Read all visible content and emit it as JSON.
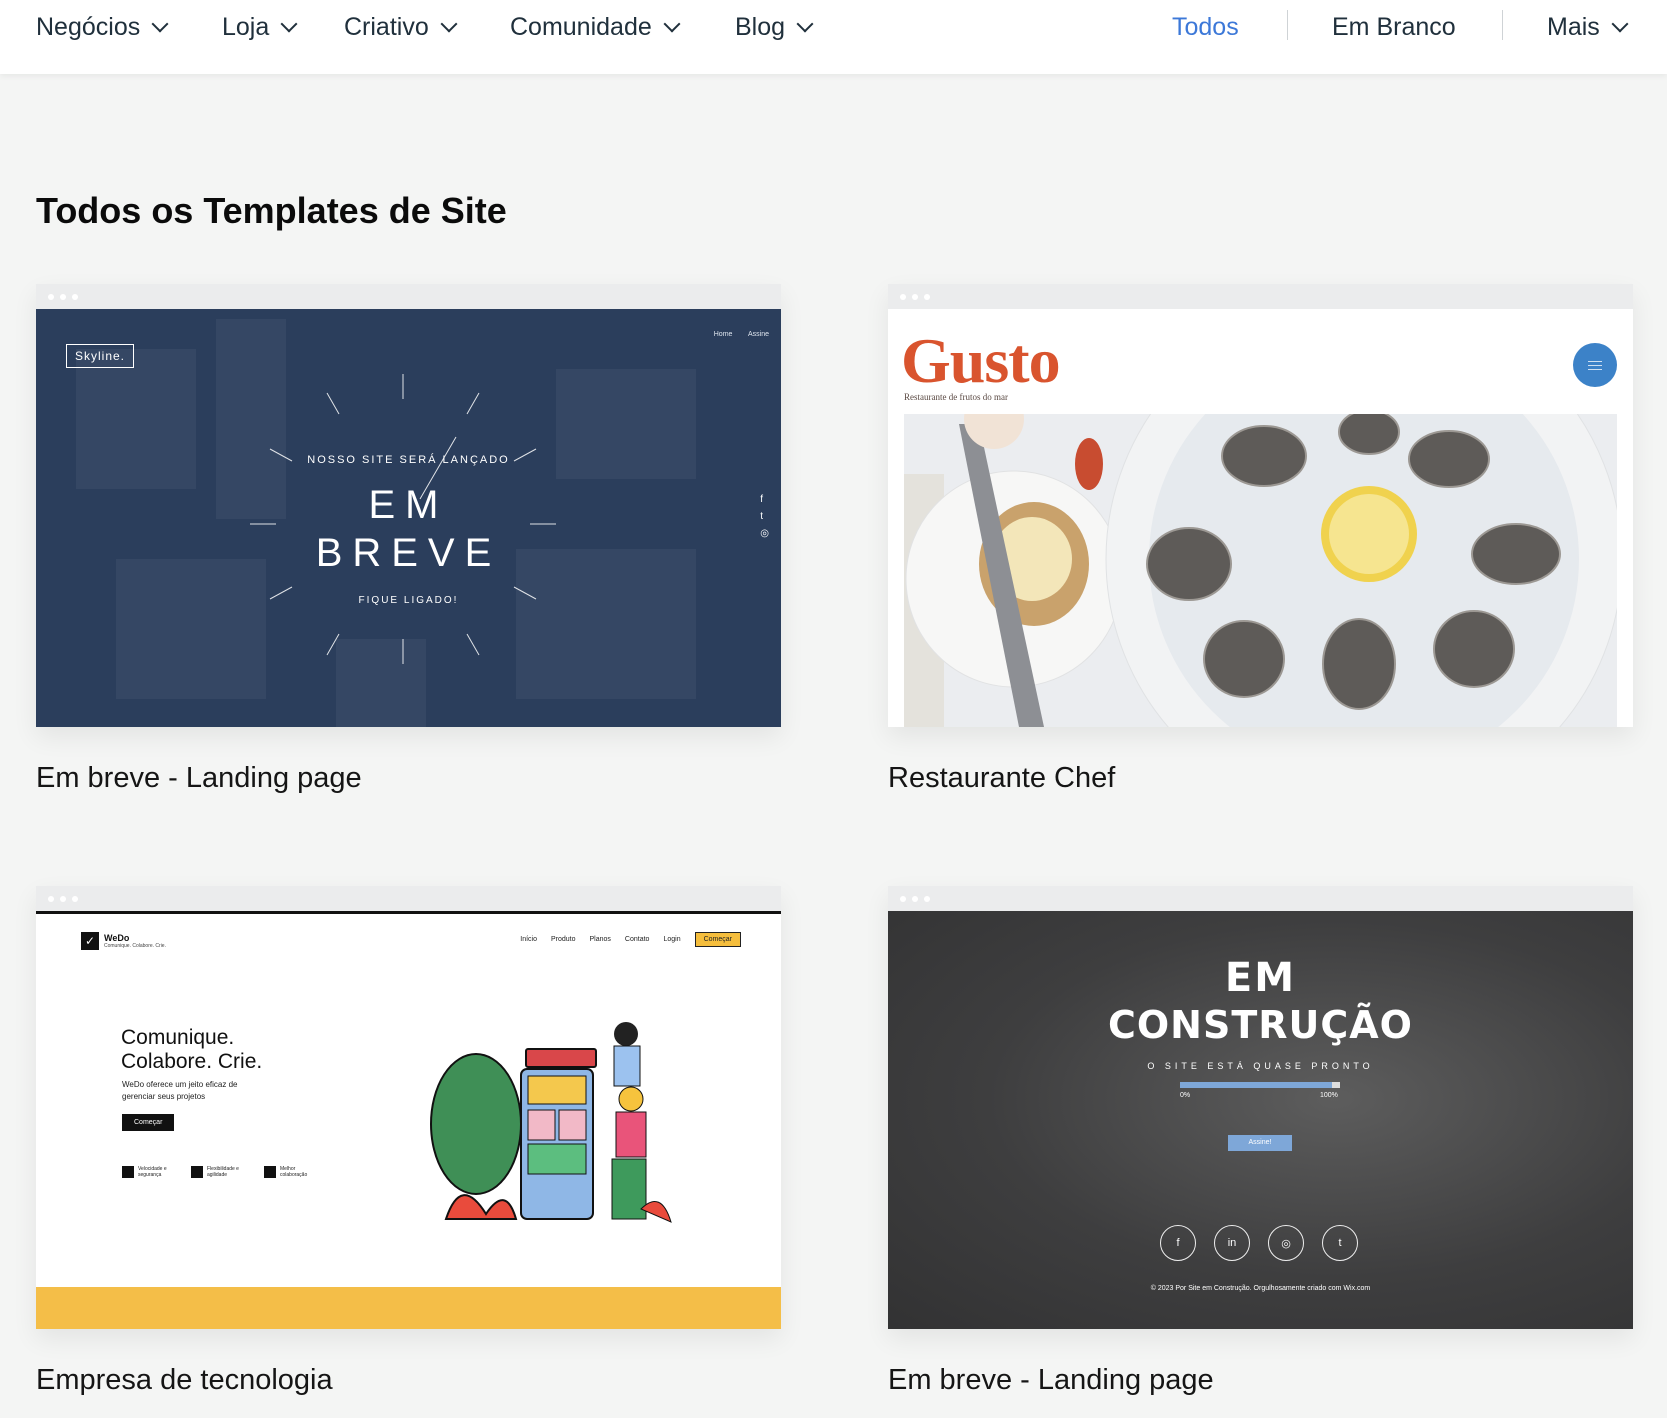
{
  "nav": {
    "left": [
      {
        "label": "Negócios"
      },
      {
        "label": "Loja"
      },
      {
        "label": "Criativo"
      },
      {
        "label": "Comunidade"
      },
      {
        "label": "Blog"
      }
    ],
    "right": {
      "todos": "Todos",
      "em_branco": "Em Branco",
      "mais": "Mais"
    },
    "active_color": "#3c78d8"
  },
  "page_title": "Todos os Templates de Site",
  "cards": [
    {
      "title": "Em breve - Landing page",
      "preview": {
        "logo": "Skyline.",
        "links": "Home Assine",
        "subtitle": "NOSSO SITE SERÁ LANÇADO",
        "line1": "EM",
        "line2": "BREVE",
        "bottom": "FIQUE LIGADO!",
        "social": [
          "f",
          "t",
          "◎"
        ]
      }
    },
    {
      "title": "Restaurante Chef",
      "preview": {
        "logo": "Gusto",
        "tagline": "Restaurante de frutos do mar",
        "brand_color": "#d9542e"
      }
    },
    {
      "title": "Empresa de tecnologia",
      "preview": {
        "logo": "WeDo",
        "logo_tag": "Comunique. Colabore. Crie.",
        "nav": [
          "Início",
          "Produto",
          "Planos",
          "Contato",
          "Login"
        ],
        "cta": "Começar",
        "headline1": "Comunique.",
        "headline2": "Colabore. Crie.",
        "paragraph": "WeDo oferece um jeito eficaz de gerenciar seus projetos",
        "button": "Começar",
        "features": [
          "Velocidade e segurança",
          "Flexibilidade e agilidade",
          "Melhor colaboração"
        ],
        "accent": "#f4be48"
      }
    },
    {
      "title": "Em breve - Landing page",
      "preview": {
        "line1": "EM",
        "line2": "CONSTRUÇÃO",
        "subtitle": "O SITE ESTÁ QUASE PRONTO",
        "progress": 0.95,
        "label_min": "0%",
        "label_max": "100%",
        "button": "Assine!",
        "social": [
          "f",
          "in",
          "◎",
          "t"
        ],
        "footer": "© 2023 Por Site em Construção. Orgulhosamente criado com Wix.com"
      }
    }
  ]
}
